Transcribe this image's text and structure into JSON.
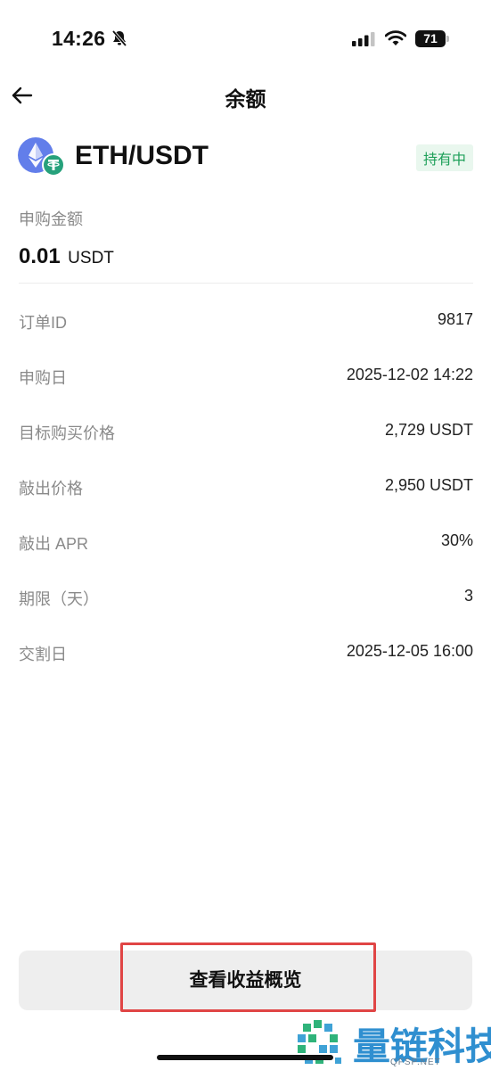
{
  "status_bar": {
    "time": "14:26",
    "battery": "71",
    "icons": [
      "bell-slash-icon",
      "cellular-signal-icon",
      "wifi-icon",
      "battery-icon"
    ]
  },
  "nav": {
    "title": "余额",
    "back_icon": "arrow-left-icon"
  },
  "pair": {
    "name": "ETH/USDT",
    "status": "持有中",
    "status_color": "#1fa05a",
    "icons": [
      "eth-icon",
      "usdt-icon"
    ]
  },
  "subscription": {
    "label": "申购金额",
    "amount": "0.01",
    "unit": "USDT"
  },
  "details": [
    {
      "label": "订单ID",
      "value": "9817"
    },
    {
      "label": "申购日",
      "value": "2025-12-02 14:22"
    },
    {
      "label": "目标购买价格",
      "value": "2,729 USDT"
    },
    {
      "label": "敲出价格",
      "value": "2,950 USDT"
    },
    {
      "label": "敲出 APR",
      "value": "30%"
    },
    {
      "label": "期限（天）",
      "value": "3"
    },
    {
      "label": "交割日",
      "value": "2025-12-05 16:00"
    }
  ],
  "actions": {
    "overview_button": "查看收益概览",
    "highlight_color": "#e04545"
  },
  "watermark": {
    "text": "量链科技",
    "subtext": "QFSP.NET"
  }
}
